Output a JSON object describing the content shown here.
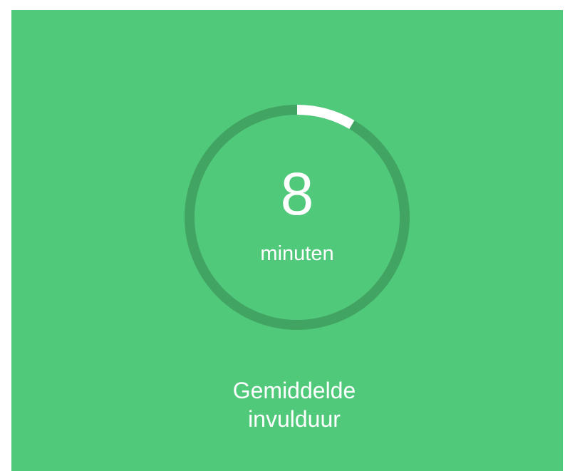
{
  "stat": {
    "value": "8",
    "unit": "minuten",
    "progress_fraction": 0.085,
    "caption_line1": "Gemiddelde",
    "caption_line2": "invulduur"
  },
  "colors": {
    "background": "#51c97b",
    "ring_track": "#41a462",
    "ring_progress": "#ffffff",
    "text": "#ffffff"
  }
}
